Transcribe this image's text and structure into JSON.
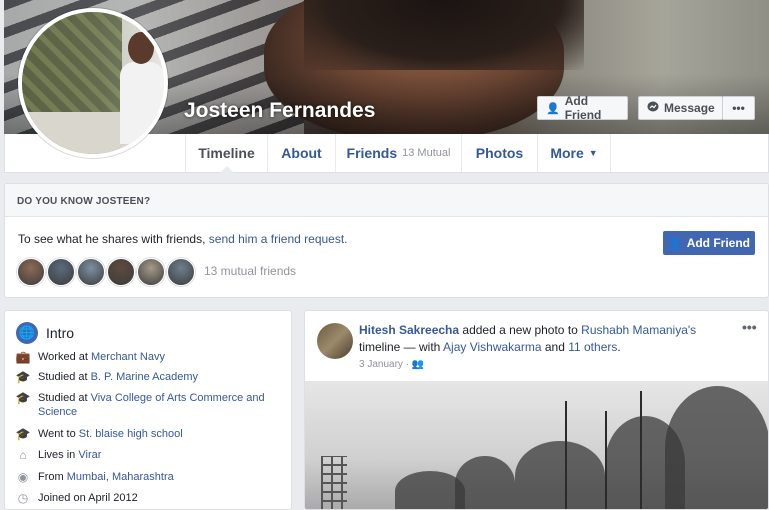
{
  "profile": {
    "name": "Josteen Fernandes",
    "add_friend_label": "Add Friend",
    "message_label": "Message",
    "more_label": "•••"
  },
  "tabs": [
    {
      "label": "Timeline"
    },
    {
      "label": "About"
    },
    {
      "label": "Friends",
      "sub": "13 Mutual"
    },
    {
      "label": "Photos"
    },
    {
      "label": "More"
    }
  ],
  "know": {
    "heading": "DO YOU KNOW JOSTEEN?",
    "text_before": "To see what he shares with friends, ",
    "link_text": "send him a friend request.",
    "button_label": "Add Friend",
    "mutual_count": "13 mutual friends",
    "mutual_colors": [
      "#8c6a55",
      "#5b6b7c",
      "#7d8fa3",
      "#5e4a3d",
      "#a59a88",
      "#6e7f8d"
    ]
  },
  "intro": {
    "title": "Intro",
    "rows": [
      {
        "icon": "briefcase-icon",
        "prefix": "Worked at ",
        "link": "Merchant Navy"
      },
      {
        "icon": "graduation-cap-icon",
        "prefix": "Studied at ",
        "link": "B. P. Marine Academy"
      },
      {
        "icon": "graduation-cap-icon",
        "prefix": "Studied at ",
        "link": "Viva College of Arts Commerce and Science"
      },
      {
        "icon": "graduation-cap-icon",
        "prefix": "Went to ",
        "link": "St. blaise high school"
      },
      {
        "icon": "home-icon",
        "prefix": "Lives in ",
        "link": "Virar"
      },
      {
        "icon": "location-pin-icon",
        "prefix": "From ",
        "link": "Mumbai, Maharashtra"
      },
      {
        "icon": "clock-icon",
        "prefix": "Joined on April 2012",
        "link": ""
      }
    ]
  },
  "post": {
    "author": "Hitesh Sakreecha",
    "action": " added a new photo to ",
    "target": "Rushabh Mamaniya's",
    "line2_prefix": "timeline — with ",
    "with_1": "Ajay Vishwakarma",
    "and": " and ",
    "with_others": "11 others",
    "period": ".",
    "date": "3 January",
    "menu": "•••"
  }
}
